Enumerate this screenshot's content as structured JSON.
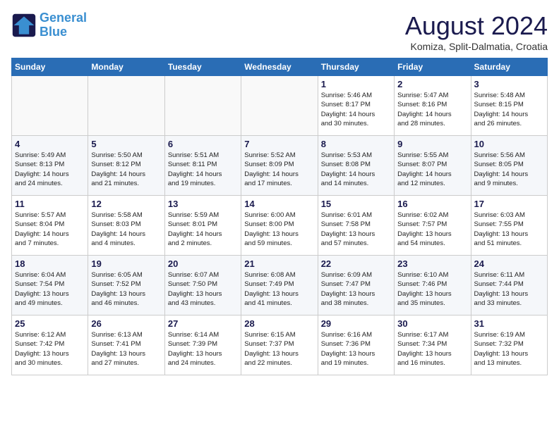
{
  "header": {
    "logo_line1": "General",
    "logo_line2": "Blue",
    "month_year": "August 2024",
    "location": "Komiza, Split-Dalmatia, Croatia"
  },
  "weekdays": [
    "Sunday",
    "Monday",
    "Tuesday",
    "Wednesday",
    "Thursday",
    "Friday",
    "Saturday"
  ],
  "weeks": [
    [
      {
        "day": "",
        "info": ""
      },
      {
        "day": "",
        "info": ""
      },
      {
        "day": "",
        "info": ""
      },
      {
        "day": "",
        "info": ""
      },
      {
        "day": "1",
        "info": "Sunrise: 5:46 AM\nSunset: 8:17 PM\nDaylight: 14 hours\nand 30 minutes."
      },
      {
        "day": "2",
        "info": "Sunrise: 5:47 AM\nSunset: 8:16 PM\nDaylight: 14 hours\nand 28 minutes."
      },
      {
        "day": "3",
        "info": "Sunrise: 5:48 AM\nSunset: 8:15 PM\nDaylight: 14 hours\nand 26 minutes."
      }
    ],
    [
      {
        "day": "4",
        "info": "Sunrise: 5:49 AM\nSunset: 8:13 PM\nDaylight: 14 hours\nand 24 minutes."
      },
      {
        "day": "5",
        "info": "Sunrise: 5:50 AM\nSunset: 8:12 PM\nDaylight: 14 hours\nand 21 minutes."
      },
      {
        "day": "6",
        "info": "Sunrise: 5:51 AM\nSunset: 8:11 PM\nDaylight: 14 hours\nand 19 minutes."
      },
      {
        "day": "7",
        "info": "Sunrise: 5:52 AM\nSunset: 8:09 PM\nDaylight: 14 hours\nand 17 minutes."
      },
      {
        "day": "8",
        "info": "Sunrise: 5:53 AM\nSunset: 8:08 PM\nDaylight: 14 hours\nand 14 minutes."
      },
      {
        "day": "9",
        "info": "Sunrise: 5:55 AM\nSunset: 8:07 PM\nDaylight: 14 hours\nand 12 minutes."
      },
      {
        "day": "10",
        "info": "Sunrise: 5:56 AM\nSunset: 8:05 PM\nDaylight: 14 hours\nand 9 minutes."
      }
    ],
    [
      {
        "day": "11",
        "info": "Sunrise: 5:57 AM\nSunset: 8:04 PM\nDaylight: 14 hours\nand 7 minutes."
      },
      {
        "day": "12",
        "info": "Sunrise: 5:58 AM\nSunset: 8:03 PM\nDaylight: 14 hours\nand 4 minutes."
      },
      {
        "day": "13",
        "info": "Sunrise: 5:59 AM\nSunset: 8:01 PM\nDaylight: 14 hours\nand 2 minutes."
      },
      {
        "day": "14",
        "info": "Sunrise: 6:00 AM\nSunset: 8:00 PM\nDaylight: 13 hours\nand 59 minutes."
      },
      {
        "day": "15",
        "info": "Sunrise: 6:01 AM\nSunset: 7:58 PM\nDaylight: 13 hours\nand 57 minutes."
      },
      {
        "day": "16",
        "info": "Sunrise: 6:02 AM\nSunset: 7:57 PM\nDaylight: 13 hours\nand 54 minutes."
      },
      {
        "day": "17",
        "info": "Sunrise: 6:03 AM\nSunset: 7:55 PM\nDaylight: 13 hours\nand 51 minutes."
      }
    ],
    [
      {
        "day": "18",
        "info": "Sunrise: 6:04 AM\nSunset: 7:54 PM\nDaylight: 13 hours\nand 49 minutes."
      },
      {
        "day": "19",
        "info": "Sunrise: 6:05 AM\nSunset: 7:52 PM\nDaylight: 13 hours\nand 46 minutes."
      },
      {
        "day": "20",
        "info": "Sunrise: 6:07 AM\nSunset: 7:50 PM\nDaylight: 13 hours\nand 43 minutes."
      },
      {
        "day": "21",
        "info": "Sunrise: 6:08 AM\nSunset: 7:49 PM\nDaylight: 13 hours\nand 41 minutes."
      },
      {
        "day": "22",
        "info": "Sunrise: 6:09 AM\nSunset: 7:47 PM\nDaylight: 13 hours\nand 38 minutes."
      },
      {
        "day": "23",
        "info": "Sunrise: 6:10 AM\nSunset: 7:46 PM\nDaylight: 13 hours\nand 35 minutes."
      },
      {
        "day": "24",
        "info": "Sunrise: 6:11 AM\nSunset: 7:44 PM\nDaylight: 13 hours\nand 33 minutes."
      }
    ],
    [
      {
        "day": "25",
        "info": "Sunrise: 6:12 AM\nSunset: 7:42 PM\nDaylight: 13 hours\nand 30 minutes."
      },
      {
        "day": "26",
        "info": "Sunrise: 6:13 AM\nSunset: 7:41 PM\nDaylight: 13 hours\nand 27 minutes."
      },
      {
        "day": "27",
        "info": "Sunrise: 6:14 AM\nSunset: 7:39 PM\nDaylight: 13 hours\nand 24 minutes."
      },
      {
        "day": "28",
        "info": "Sunrise: 6:15 AM\nSunset: 7:37 PM\nDaylight: 13 hours\nand 22 minutes."
      },
      {
        "day": "29",
        "info": "Sunrise: 6:16 AM\nSunset: 7:36 PM\nDaylight: 13 hours\nand 19 minutes."
      },
      {
        "day": "30",
        "info": "Sunrise: 6:17 AM\nSunset: 7:34 PM\nDaylight: 13 hours\nand 16 minutes."
      },
      {
        "day": "31",
        "info": "Sunrise: 6:19 AM\nSunset: 7:32 PM\nDaylight: 13 hours\nand 13 minutes."
      }
    ]
  ]
}
